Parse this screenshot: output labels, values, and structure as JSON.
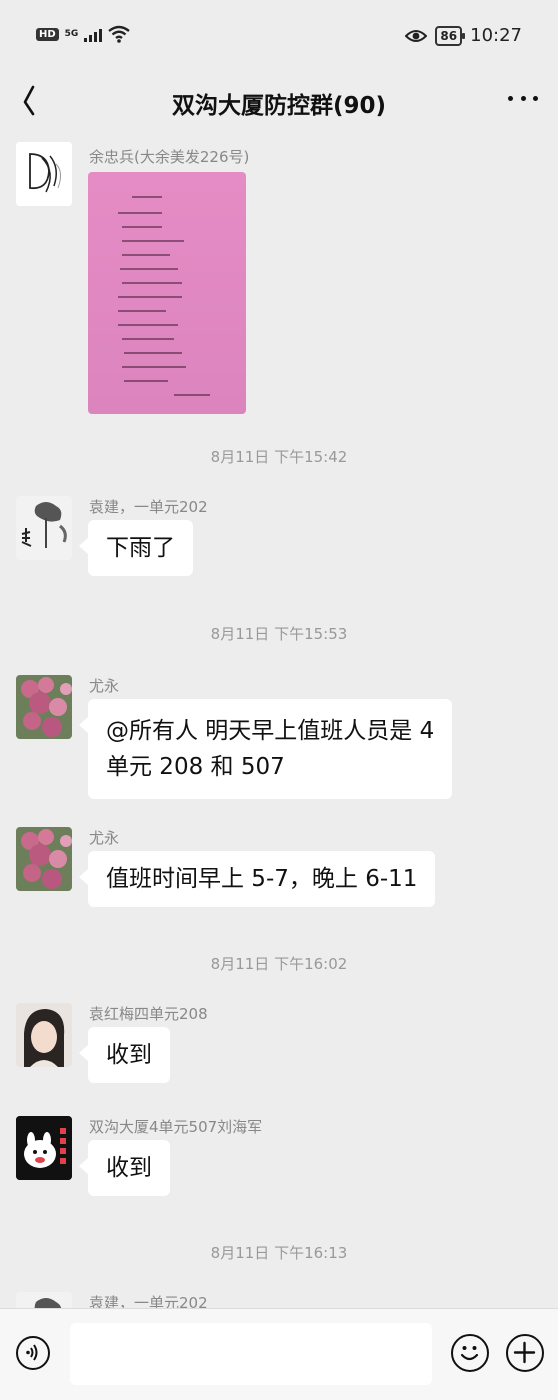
{
  "status_bar": {
    "hd": "HD",
    "network": "5G",
    "battery": "86",
    "time": "10:27"
  },
  "header": {
    "title": "双沟大厦防控群(90)"
  },
  "messages": [
    {
      "sender": "余忠兵(大余美发226号)",
      "type": "image",
      "avatar": "logo-avatar"
    },
    {
      "timestamp": "8月11日 下午15:42"
    },
    {
      "sender": "袁建，一单元202",
      "type": "text",
      "lines": [
        "下雨了"
      ],
      "avatar": "ink-painting-avatar"
    },
    {
      "timestamp": "8月11日 下午15:53"
    },
    {
      "sender": "尤永",
      "type": "text",
      "lines": [
        "@所有人  明天早上值班人员是 4",
        "单元 208 和 507"
      ],
      "avatar": "flower-avatar"
    },
    {
      "sender": "尤永",
      "type": "text",
      "lines": [
        "值班时间早上 5-7，晚上 6-11"
      ],
      "avatar": "flower-avatar"
    },
    {
      "timestamp": "8月11日 下午16:02"
    },
    {
      "sender": "袁红梅四单元208",
      "type": "text",
      "lines": [
        "收到"
      ],
      "avatar": "person-avatar"
    },
    {
      "sender": "双沟大厦4单元507刘海军",
      "type": "text",
      "lines": [
        "收到"
      ],
      "avatar": "cartoon-avatar"
    },
    {
      "timestamp": "8月11日 下午16:13"
    },
    {
      "sender": "袁建，一单元202",
      "type": "text",
      "avatar": "ink-painting-avatar"
    }
  ],
  "colors": {
    "background": "#ededed",
    "bubble": "#ffffff",
    "photo": "#e58cc5"
  }
}
